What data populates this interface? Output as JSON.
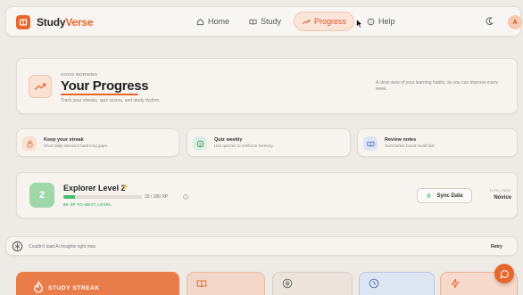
{
  "brand": {
    "part1": "Study",
    "part2": "Verse",
    "logo_icon": "book-icon"
  },
  "nav": [
    {
      "label": "Home",
      "icon": "home-icon",
      "active": false
    },
    {
      "label": "Study",
      "icon": "open-book-icon",
      "active": false
    },
    {
      "label": "Progress",
      "icon": "trend-up-icon",
      "active": true
    },
    {
      "label": "Help",
      "icon": "help-circle-icon",
      "active": false
    }
  ],
  "header": {
    "theme_icon": "moon-icon",
    "avatar_initial": "A"
  },
  "hero": {
    "greeting": "GOOD MORNING",
    "title": "Your Progress",
    "subtitle": "Track your streaks, quiz scores, and study rhythm.",
    "description": "A clear view of your learning habits, so you can improve every week.",
    "icon": "trend-up-icon"
  },
  "tips": [
    {
      "title": "Keep your streak",
      "subtitle": "Short daily sessions beat long gaps.",
      "icon": "flame-icon"
    },
    {
      "title": "Quiz weekly",
      "subtitle": "Use quizzes to reinforce memory.",
      "icon": "quiz-icon"
    },
    {
      "title": "Review notes",
      "subtitle": "Summaries boost recall fast.",
      "icon": "notes-icon"
    }
  ],
  "level": {
    "badge": "2",
    "title": "Explorer Level 2",
    "xp_text": "15 / 100 XP",
    "xp_fraction": 0.15,
    "next_text": "85 XP TO NEXT LEVEL",
    "sync_label": "Sync Data",
    "rank_label": "TOTAL RANK",
    "rank_value": "Novice"
  },
  "alert": {
    "text": "Couldn't load AI insights right now.",
    "retry_label": "Retry",
    "icon": "brain-icon"
  },
  "stats": [
    {
      "label": "STUDY STREAK",
      "icon": "flame-icon"
    },
    {
      "label": "",
      "icon": "book-icon"
    },
    {
      "label": "",
      "icon": "brain-icon"
    },
    {
      "label": "",
      "icon": "clock-icon"
    },
    {
      "label": "",
      "icon": "lightning-icon"
    }
  ],
  "colors": {
    "accent": "#e8662c",
    "success": "#4bbd74",
    "background": "#eeebe6"
  }
}
